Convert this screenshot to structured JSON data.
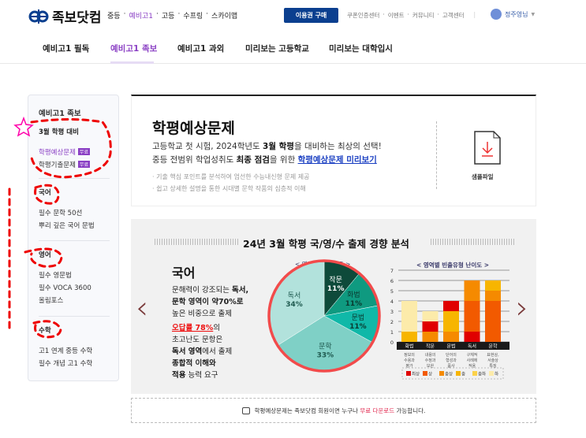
{
  "header": {
    "logo_text": "족보닷컴",
    "levels": [
      "중등",
      "예비고1",
      "고등",
      "수프링",
      "스카이맵"
    ],
    "active_level": "예비고1",
    "buy_button": "이용권 구매",
    "util_links": [
      "쿠폰인증센터",
      "이벤트",
      "커뮤니티",
      "고객센터"
    ],
    "user_name": "정주영님"
  },
  "gnb": {
    "items": [
      "예비고1 필독",
      "예비고1 족보",
      "예비고1 과외",
      "미리보는 고등학교",
      "미리보는 대학입시"
    ],
    "active": "예비고1 족보"
  },
  "sidebar": {
    "title": "예비고1 족보",
    "march": {
      "heading": "3월 학평 대비",
      "items": [
        {
          "label": "학평예상문제",
          "badge": "무료",
          "active": true
        },
        {
          "label": "학평기출문제",
          "badge": "무료"
        }
      ]
    },
    "korean": {
      "heading": "국어",
      "items": [
        "필수 문학 50선",
        "뿌리 깊은 국어 문법"
      ]
    },
    "english": {
      "heading": "영어",
      "items": [
        "필수 영문법",
        "필수 VOCA 3600",
        "올림포스"
      ]
    },
    "math": {
      "heading": "수학",
      "items": [
        "고1 연계 중등 수학",
        "필수 개념 고1 수학"
      ]
    }
  },
  "intro": {
    "title": "학평예상문제",
    "line1_a": "고등학교 첫 시험, 2024학년도 ",
    "line1_b": "3월 학평",
    "line1_c": "을 대비하는 최상의 선택!",
    "line2_a": "중등 전범위 학업성취도 ",
    "line2_b": "최종 점검",
    "line2_c": "을 위한 ",
    "line2_link": "학평예상문제 미리보기",
    "bullets": [
      "· 기출 핵심 포인트를 분석하여 엄선한 수능내신형 문제 제공",
      "· 쉽고 상세한 설명을 통한 시대별 문학 작품의 심층적 이해"
    ],
    "sample_label": "샘플파일",
    "sample_icon": "download-file-icon"
  },
  "infographic": {
    "title": "24년 3월 학평 국/영/수 출제 경향 분석",
    "subject": "국어",
    "desc1": [
      "문해력이 강조되는 ",
      "독서,"
    ],
    "desc2": "문학 영역이 약70%로",
    "desc3": "높은 비중으로 출제",
    "desc4_red": "오답률 78%",
    "desc4_rest": "의",
    "desc5": "초고난도 문항은",
    "desc6_b": "독서 영역",
    "desc6_rest": "에서 출제",
    "desc7": "종합적 이해와",
    "desc8_b": "적용",
    "desc8_rest": " 능력 요구"
  },
  "chart_data": [
    {
      "type": "pie",
      "title": "< 영역별 출제 비중 >",
      "categories": [
        "작문",
        "화법",
        "문법",
        "문학",
        "독서"
      ],
      "values": [
        11,
        11,
        11,
        33,
        34
      ],
      "unit": "%",
      "colors": [
        "#0e4a3a",
        "#0f9a80",
        "#10b8a8",
        "#7fd0c6",
        "#b2e2dc"
      ]
    },
    {
      "type": "bar",
      "stacked": true,
      "title": "< 영역별 빈출유형 난이도 >",
      "categories": [
        "화법",
        "작문",
        "문법",
        "독서",
        "문학"
      ],
      "sublabels": [
        "정보의 수용과 평가",
        "내용의 수정과 보완",
        "단어의 형성과 품사",
        "구체적 사례에 적용",
        "표현상, 서술상 특징"
      ],
      "ylim": [
        0,
        7
      ],
      "yticks": [
        0,
        1,
        2,
        3,
        4,
        5,
        6,
        7
      ],
      "grid": true,
      "legend": "bottom",
      "levels": [
        {
          "name": "최상",
          "color": "#e00000"
        },
        {
          "name": "상",
          "color": "#f25a00"
        },
        {
          "name": "중상",
          "color": "#f58a00"
        },
        {
          "name": "중",
          "color": "#f7b500"
        },
        {
          "name": "중하",
          "color": "#fbd24a"
        },
        {
          "name": "하",
          "color": "#fcebaa"
        }
      ],
      "stacks": [
        [
          {
            "level": "중",
            "value": 1
          },
          {
            "level": "하",
            "value": 3
          }
        ],
        [
          {
            "level": "중상",
            "value": 1
          },
          {
            "level": "최상",
            "value": 1
          },
          {
            "level": "하",
            "value": 1
          }
        ],
        [
          {
            "level": "중상",
            "value": 1
          },
          {
            "level": "중",
            "value": 2
          },
          {
            "level": "최상",
            "value": 1
          }
        ],
        [
          {
            "level": "최상",
            "value": 1
          },
          {
            "level": "상",
            "value": 3
          },
          {
            "level": "중상",
            "value": 2
          }
        ],
        [
          {
            "level": "상",
            "value": 4
          },
          {
            "level": "중상",
            "value": 1
          },
          {
            "level": "중",
            "value": 1
          }
        ]
      ]
    }
  ],
  "footer": {
    "text_a": "학평예상문제는 족보닷컴 회원이면 누구나 ",
    "text_hl": "무료 다운로드",
    "text_b": " 가능합니다."
  },
  "colors": {
    "accent": "#8a3fc4",
    "brand": "#0b3f8f",
    "highlight": "#e11111"
  }
}
